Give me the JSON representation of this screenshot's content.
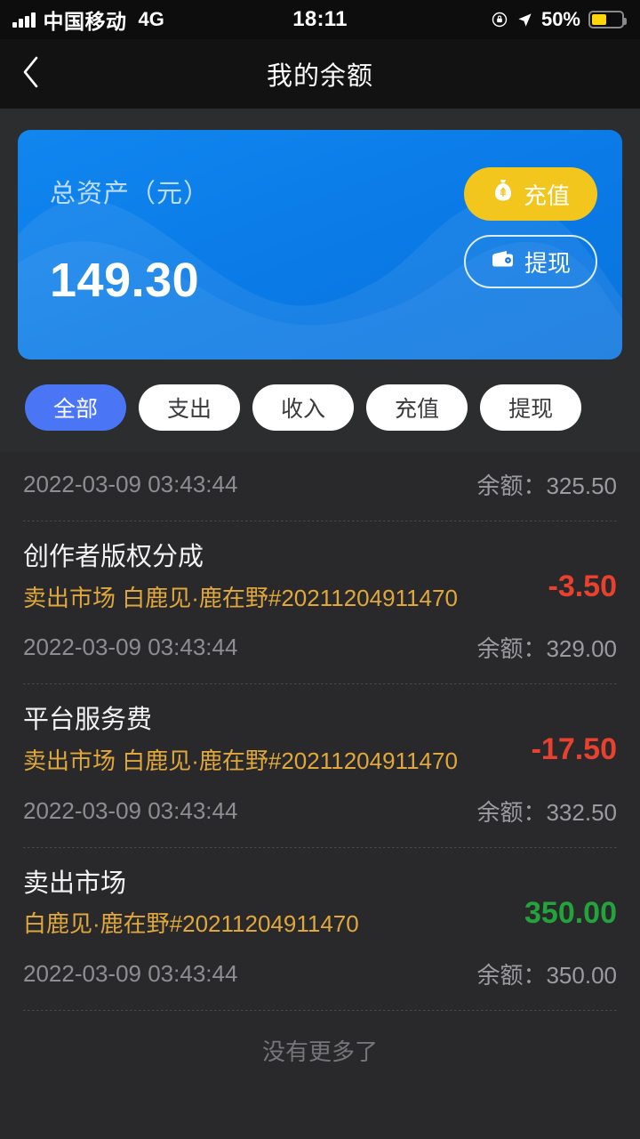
{
  "status_bar": {
    "carrier": "中国移动",
    "network": "4G",
    "time": "18:11",
    "battery_percent": "50%",
    "battery_level": 50,
    "battery_color": "#ffd60a",
    "icons": [
      "signal-icon",
      "rotation-lock-icon",
      "location-arrow-icon",
      "battery-icon"
    ]
  },
  "navbar": {
    "back_icon": "chevron-left-icon",
    "title": "我的余额"
  },
  "balance_card": {
    "label": "总资产（元）",
    "amount": "149.30",
    "background_color": "#0a7ae6",
    "topup_button": {
      "label": "充值",
      "icon": "money-bag-icon",
      "color": "#f2c61c"
    },
    "withdraw_button": {
      "label": "提现",
      "icon": "wallet-icon"
    }
  },
  "filters": {
    "active_index": 0,
    "items": [
      {
        "label": "全部",
        "active": true
      },
      {
        "label": "支出",
        "active": false
      },
      {
        "label": "收入",
        "active": false
      },
      {
        "label": "充值",
        "active": false
      },
      {
        "label": "提现",
        "active": false
      }
    ],
    "active_color": "#4a76f5"
  },
  "transactions": {
    "balance_prefix": "余额：",
    "items": [
      {
        "partial": true,
        "title": "",
        "subtitle": "",
        "amount": "",
        "amount_type": "",
        "date": "2022-03-09 03:43:44",
        "balance": "325.50",
        "balance_text": "余额：325.50"
      },
      {
        "partial": false,
        "title": "创作者版权分成",
        "subtitle": "卖出市场 白鹿见·鹿在野#20211204911470",
        "amount": "-3.50",
        "amount_type": "negative",
        "date": "2022-03-09 03:43:44",
        "balance": "329.00",
        "balance_text": "余额：329.00"
      },
      {
        "partial": false,
        "title": "平台服务费",
        "subtitle": "卖出市场 白鹿见·鹿在野#20211204911470",
        "amount": "-17.50",
        "amount_type": "negative",
        "date": "2022-03-09 03:43:44",
        "balance": "332.50",
        "balance_text": "余额：332.50"
      },
      {
        "partial": false,
        "title": "卖出市场",
        "subtitle": "白鹿见·鹿在野#20211204911470",
        "amount": "350.00",
        "amount_type": "positive",
        "date": "2022-03-09 03:43:44",
        "balance": "350.00",
        "balance_text": "余额：350.00"
      }
    ],
    "end_text": "没有更多了",
    "negative_color": "#e8412e",
    "positive_color": "#23a33c",
    "subtitle_color": "#e0a83c"
  }
}
